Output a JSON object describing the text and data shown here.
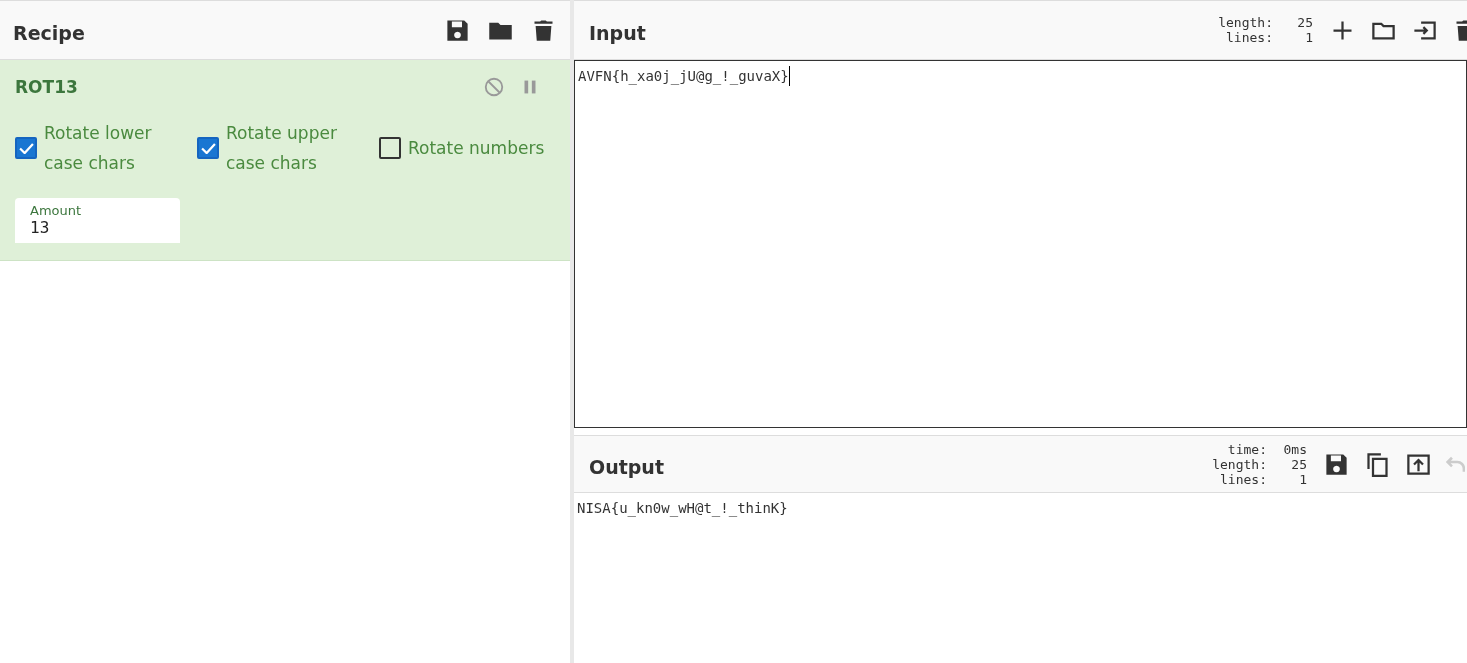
{
  "recipe": {
    "title": "Recipe",
    "operation": {
      "name": "ROT13",
      "options": [
        {
          "label": "Rotate lower case chars",
          "checked": true
        },
        {
          "label": "Rotate upper case chars",
          "checked": true
        },
        {
          "label": "Rotate numbers",
          "checked": false
        }
      ],
      "amount": {
        "label": "Amount",
        "value": "13"
      }
    }
  },
  "input": {
    "title": "Input",
    "stats": [
      {
        "label": "length:",
        "value": "25"
      },
      {
        "label": "lines:",
        "value": "1"
      }
    ],
    "value": "AVFN{h_xa0j_jU@g_!_guvaX}"
  },
  "output": {
    "title": "Output",
    "stats": [
      {
        "label": "time:",
        "value": "0ms"
      },
      {
        "label": "length:",
        "value": "25"
      },
      {
        "label": "lines:",
        "value": "1"
      }
    ],
    "undo_disabled": true,
    "value": "NISA{u_kn0w_wH@t_!_thinK}"
  }
}
